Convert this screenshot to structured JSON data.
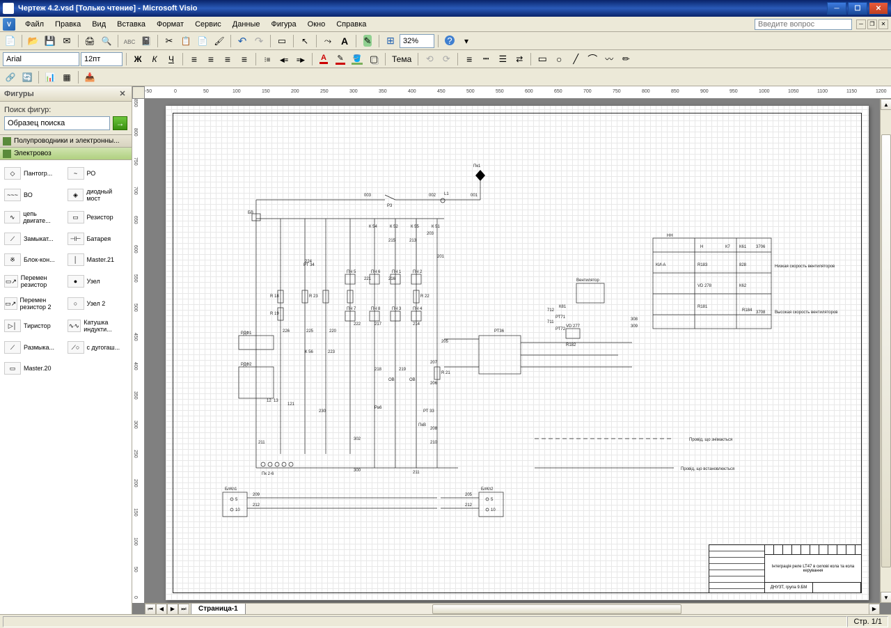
{
  "titlebar": {
    "text": "Чертеж 4.2.vsd  [Только чтение] - Microsoft Visio"
  },
  "menubar": {
    "items": [
      "Файл",
      "Правка",
      "Вид",
      "Вставка",
      "Формат",
      "Сервис",
      "Данные",
      "Фигура",
      "Окно",
      "Справка"
    ],
    "help_placeholder": "Введите вопрос"
  },
  "toolbar2": {
    "font": "Arial",
    "size": "12пт",
    "zoom": "32%",
    "theme_label": "Тема"
  },
  "shapes_pane": {
    "title": "Фигуры",
    "search_label": "Поиск фигур:",
    "search_value": "Образец поиска",
    "stencils": [
      {
        "name": "Полупроводники и электронны..."
      },
      {
        "name": "Электровоз"
      }
    ],
    "shapes": [
      {
        "label": "Пантогр...",
        "icon": "◇"
      },
      {
        "label": "РО",
        "icon": "~"
      },
      {
        "label": "ВО",
        "icon": "~~~"
      },
      {
        "label": "диодный мост",
        "icon": "◈"
      },
      {
        "label": "цепь двигате...",
        "icon": "∿"
      },
      {
        "label": "Резистор",
        "icon": "▭"
      },
      {
        "label": "Замыкат...",
        "icon": "⟋"
      },
      {
        "label": "Батарея",
        "icon": "⊣⊢"
      },
      {
        "label": "Блок-кон...",
        "icon": "※"
      },
      {
        "label": "Master.21",
        "icon": "│"
      },
      {
        "label": "Перемен резистор",
        "icon": "▭↗"
      },
      {
        "label": "Узел",
        "icon": "●"
      },
      {
        "label": "Перемен резистор 2",
        "icon": "▭↗"
      },
      {
        "label": "Узел 2",
        "icon": "○"
      },
      {
        "label": "Тиристор",
        "icon": "▷│"
      },
      {
        "label": "Катушка индукти...",
        "icon": "∿∿"
      },
      {
        "label": "Размыка...",
        "icon": "⟋"
      },
      {
        "label": "c дугогаш...",
        "icon": "⟋○"
      },
      {
        "label": "Master.20",
        "icon": "▭"
      }
    ]
  },
  "drawing": {
    "labels": {
      "pk1": "Пк1",
      "bv": "БВ",
      "p3": "Р3",
      "l1": "L1",
      "rdf1": "РДФ1",
      "rdf2": "РДФ2",
      "n003": "003",
      "n002": "002",
      "n001": "001",
      "k54": "К 54",
      "k52": "К 52",
      "k55": "К 55",
      "k51": "К 51",
      "k56": "К 56",
      "k81": "К81",
      "k61": "К61",
      "k62": "К62",
      "k7": "К7",
      "r18": "R 18",
      "r19": "R 19",
      "r23": "R 23",
      "r22": "R 22",
      "r21": "R 21",
      "r181": "R181",
      "r182": "R182",
      "r183": "R183",
      "r184": "R184",
      "n201": "201",
      "n203": "203",
      "n205": "205",
      "n206": "206",
      "n207": "207",
      "n208": "208",
      "n209": "209",
      "n210": "210",
      "n211": "211",
      "n212": "212",
      "n213": "213",
      "n214": "214",
      "n215": "215",
      "n216": "216",
      "n217": "217",
      "n218": "218",
      "n219": "219",
      "n220": "220",
      "n221": "221",
      "n222": "222",
      "n223": "223",
      "n224": "224",
      "n225": "225",
      "n226": "226",
      "n230": "230",
      "n300": "300",
      "n302": "302",
      "n308": "308",
      "n309": "309",
      "n711": "711",
      "n712": "712",
      "n828": "828",
      "n3706": "3706",
      "n3708": "3708",
      "n5": "5",
      "n10": "10",
      "n12": "12",
      "n13": "13",
      "n121": "121",
      "pt34": "РТ 34",
      "rt33": "РТ 33",
      "rt36": "РТ36",
      "rt71": "РТ71",
      "rt72": "РТ72",
      "ob": "ОВ",
      "ob1": "ОВ",
      "ra6": "Ра6",
      "pn1": "ПЧ 1",
      "pn2": "ПЧ 2",
      "pn3": "ПЧ 3",
      "pn4": "ПЧ 4",
      "pn5": "ПЧ 5",
      "pn6": "ПЧ 6",
      "pn7": "ПЧ 7",
      "pn8": "ПЧ 8",
      "blkkp1": "БлКп1",
      "blkkp2": "БлКп2",
      "vent": "Вентилятор",
      "vd277": "VD 277",
      "vd278": "VD 278",
      "kna": "KИ-A",
      "h": "H",
      "hh": "HH",
      "pb8": "ПкВ",
      "pk26": "Пк 2-6",
      "low_speed": "Низкая скорость вентиляторов",
      "high_speed": "Высокая скорость вентиляторов"
    },
    "legend": {
      "removed": "Провід, що знімається",
      "installed": "Провід, що встановлюється"
    },
    "title_block": {
      "main": "Інтеграція реле LT47 в силові кола та кола керування",
      "org": "ДНУЗТ, група 9.БМ"
    }
  },
  "ruler": {
    "h": [
      "-50",
      "0",
      "50",
      "100",
      "150",
      "200",
      "250",
      "300",
      "350",
      "400",
      "450",
      "500",
      "550",
      "600",
      "650",
      "700",
      "750",
      "800",
      "850",
      "900",
      "950",
      "1000",
      "1050",
      "1100",
      "1150",
      "1200"
    ],
    "v": [
      "850",
      "800",
      "750",
      "700",
      "650",
      "600",
      "550",
      "500",
      "450",
      "400",
      "350",
      "300",
      "250",
      "200",
      "150",
      "100",
      "50",
      "0"
    ]
  },
  "page_tab": "Страница-1",
  "status": {
    "page": "Стр. 1/1"
  }
}
